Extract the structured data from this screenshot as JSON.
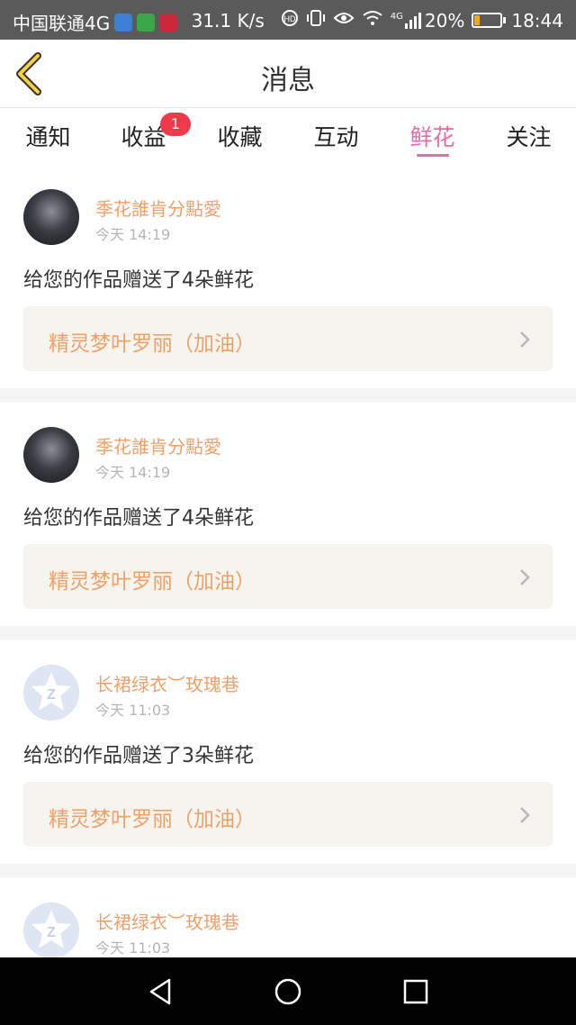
{
  "status_bar": {
    "carrier": "中国联通4G",
    "speed": "31.1 K/s",
    "signal": "4G",
    "battery": "20%",
    "battery_level": 0.2,
    "time": "18:44",
    "icons": [
      "shield-app-icon",
      "messaging-app-icon",
      "puzzle-app-icon",
      "hd-icon",
      "vibrate-icon",
      "eye-comfort-icon",
      "wifi-icon",
      "signal-icon"
    ]
  },
  "header": {
    "title": "消息",
    "back_icon": "chevron-left-icon"
  },
  "tabs": [
    {
      "label": "通知",
      "active": false
    },
    {
      "label": "收益",
      "active": false,
      "badge": "1"
    },
    {
      "label": "收藏",
      "active": false
    },
    {
      "label": "互动",
      "active": false
    },
    {
      "label": "鲜花",
      "active": true
    },
    {
      "label": "关注",
      "active": false
    }
  ],
  "colors": {
    "accent": "#e86aa6",
    "username": "#f1a06a",
    "badge": "#f03a4a",
    "work_bg": "#f5f4ee"
  },
  "messages": [
    {
      "user": "季花誰肯分點愛",
      "time": "今天 14:19",
      "text": "给您的作品赠送了4朵鲜花",
      "work": "精灵梦叶罗丽（加油）",
      "avatar": "photo"
    },
    {
      "user": "季花誰肯分點愛",
      "time": "今天 14:19",
      "text": "给您的作品赠送了4朵鲜花",
      "work": "精灵梦叶罗丽（加油）",
      "avatar": "photo"
    },
    {
      "user": "长裙绿衣︶玫瑰巷",
      "time": "今天 11:03",
      "text": "给您的作品赠送了3朵鲜花",
      "work": "精灵梦叶罗丽（加油）",
      "avatar": "default"
    },
    {
      "user": "长裙绿衣︶玫瑰巷",
      "time": "今天 11:03",
      "text": "",
      "work": "",
      "avatar": "default"
    }
  ],
  "nav_bar": {
    "buttons": [
      "back-triangle-icon",
      "home-circle-icon",
      "recents-square-icon"
    ]
  }
}
